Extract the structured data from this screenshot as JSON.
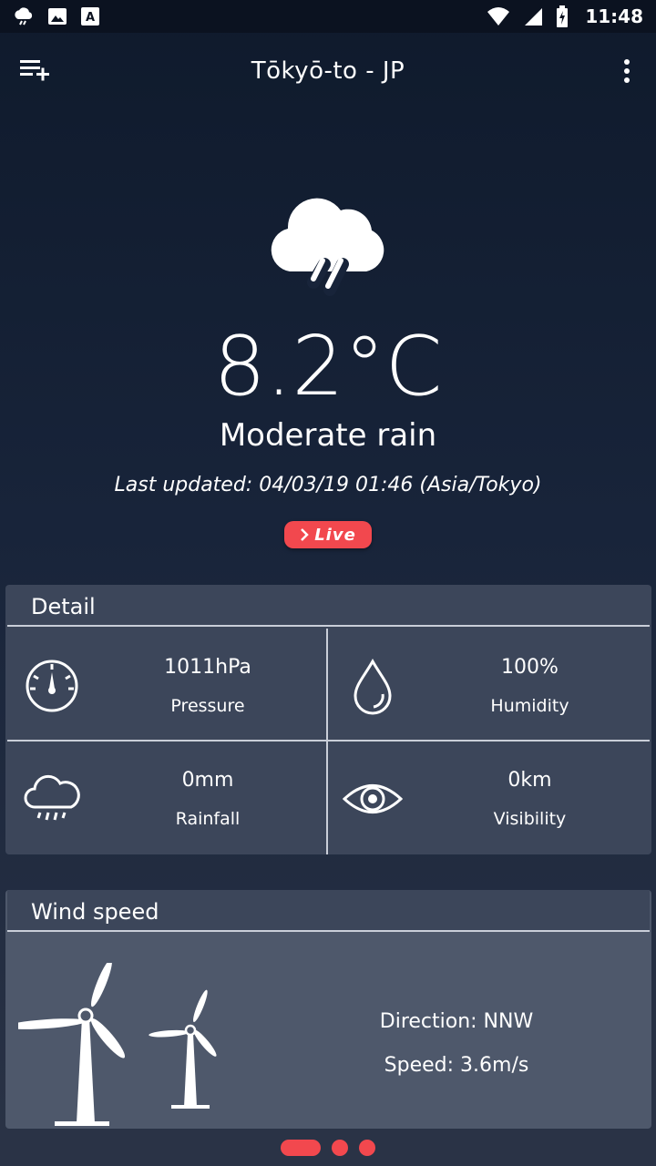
{
  "status_bar": {
    "time": "11:48",
    "left_icons": [
      "weather-notification-icon",
      "image-notification-icon",
      "text-notification-icon"
    ],
    "right_icons": [
      "wifi-icon",
      "signal-icon",
      "battery-charging-icon"
    ]
  },
  "app_bar": {
    "title": "Tōkyō-to - JP",
    "left_icon": "playlist-add-icon",
    "right_icon": "more-vert-icon"
  },
  "weather": {
    "icon": "rain-cloud-icon",
    "temperature": "8.2°C",
    "condition": "Moderate rain",
    "last_updated": "Last updated: 04/03/19 01:46 (Asia/Tokyo)",
    "live_label": "Live"
  },
  "detail": {
    "title": "Detail",
    "items": [
      {
        "icon": "gauge-icon",
        "value": "1011hPa",
        "label": "Pressure"
      },
      {
        "icon": "water-drop-icon",
        "value": "100%",
        "label": "Humidity"
      },
      {
        "icon": "rain-cloud-icon",
        "value": "0mm",
        "label": "Rainfall"
      },
      {
        "icon": "eye-icon",
        "value": "0km",
        "label": "Visibility"
      }
    ]
  },
  "wind": {
    "title": "Wind speed",
    "direction": "Direction: NNW",
    "speed": "Speed: 3.6m/s"
  },
  "pager": {
    "page_count": 3,
    "active_index": 0
  },
  "colors": {
    "accent": "#f2484e",
    "card_bg": "#3c465a",
    "wind_card_bg": "#4e586b",
    "background_top": "#0f1a2c",
    "background_bottom": "#2a3346"
  }
}
